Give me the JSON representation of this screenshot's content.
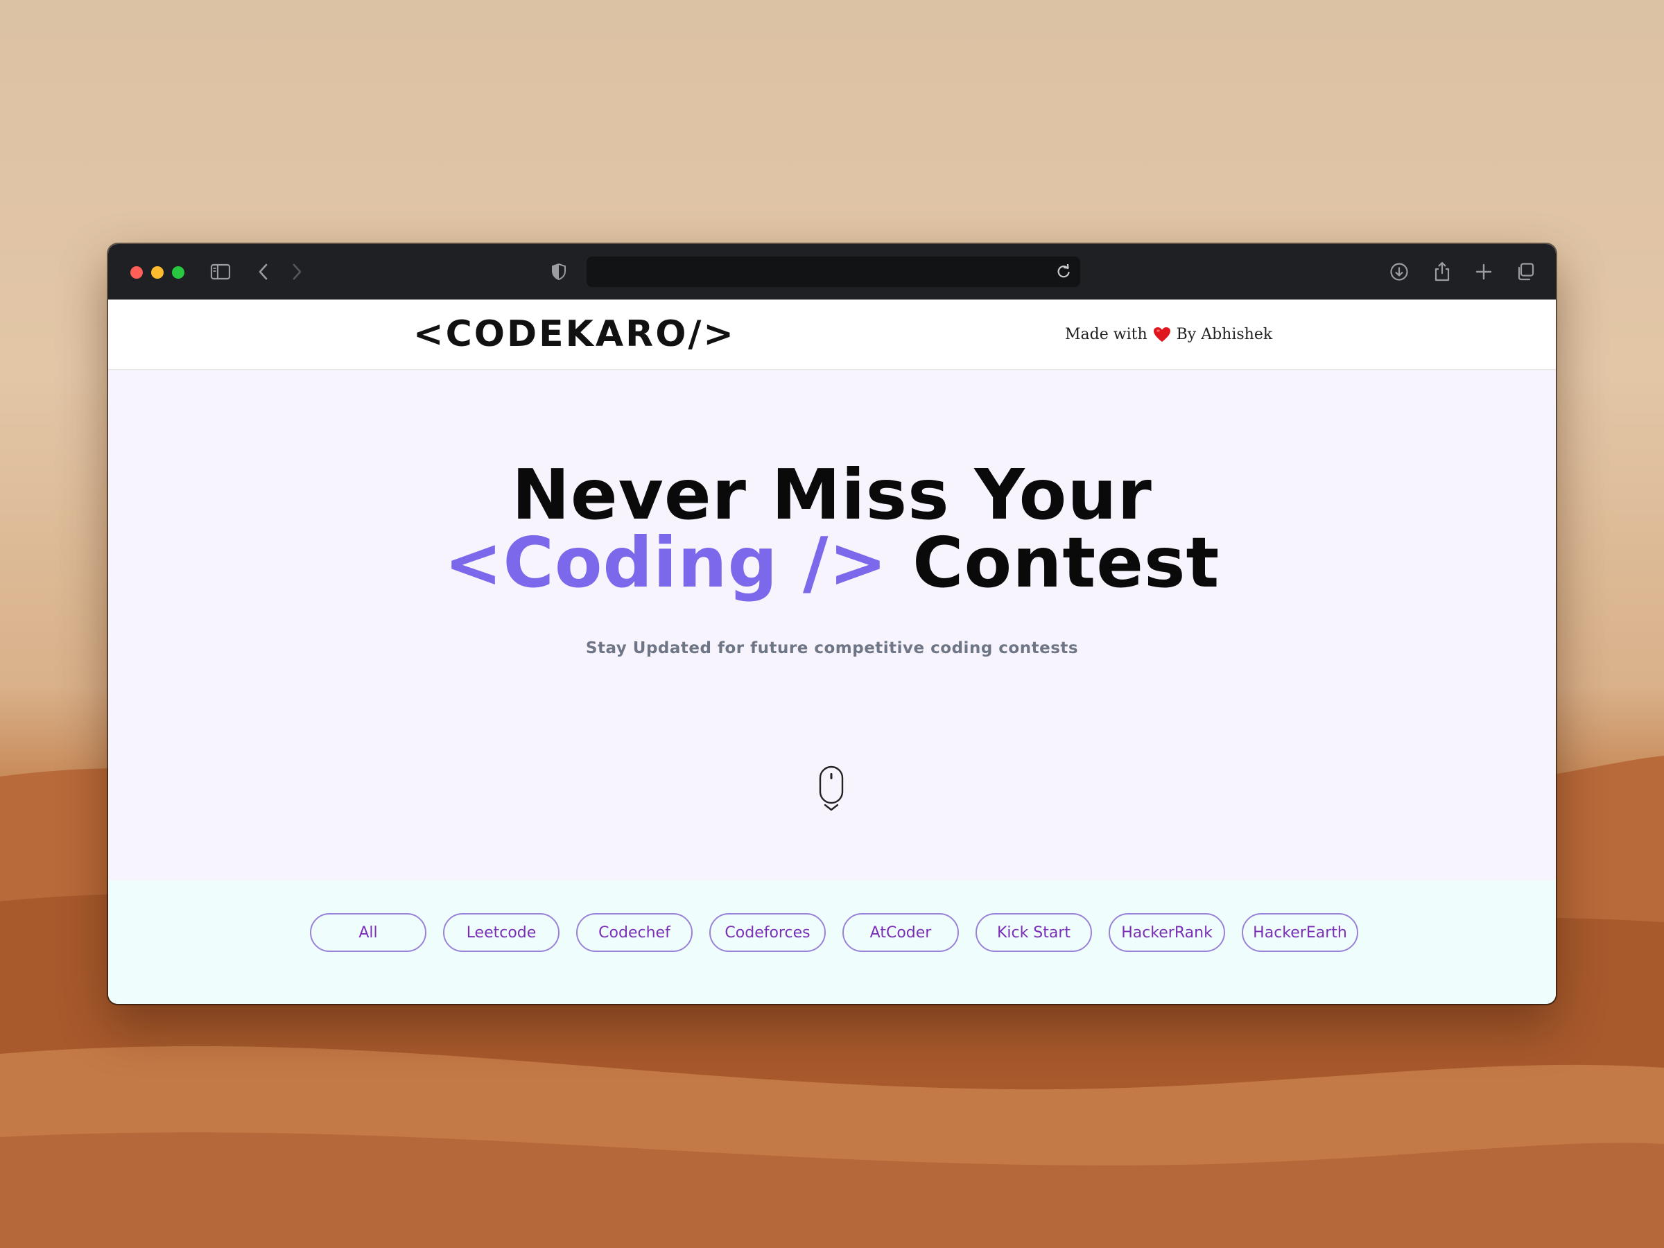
{
  "browser": {
    "url": "",
    "icons": [
      "sidebar-icon",
      "back-icon",
      "forward-icon",
      "shield-icon",
      "reload-icon",
      "download-icon",
      "share-icon",
      "new-tab-icon",
      "tabs-overview-icon"
    ]
  },
  "nav": {
    "logo": "<CODEKARO/>",
    "made_with_prefix": "Made with",
    "made_with_suffix": "By Abhishek",
    "heart_color": "#e0161e"
  },
  "hero": {
    "line1": "Never Miss Your",
    "line2_accent": "<Coding />",
    "line2_rest": " Contest",
    "subtitle": "Stay Updated for future competitive coding contests",
    "accent_color": "#7c68ea"
  },
  "filters": {
    "items": [
      "All",
      "Leetcode",
      "Codechef",
      "Codeforces",
      "AtCoder",
      "Kick Start",
      "HackerRank",
      "HackerEarth"
    ],
    "color": "#7b2fb8"
  }
}
